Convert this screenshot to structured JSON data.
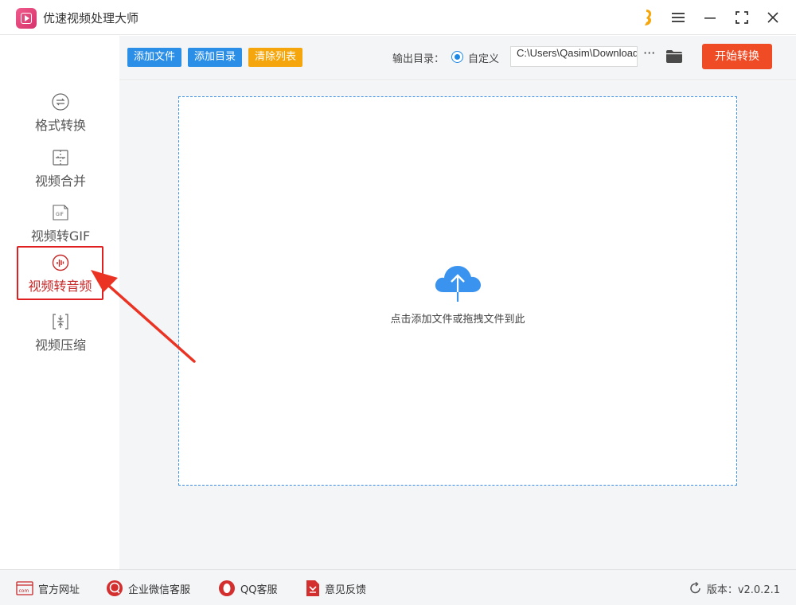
{
  "app": {
    "title": "优速视频处理大师"
  },
  "sidebar": {
    "items": [
      {
        "label": "格式转换"
      },
      {
        "label": "视频合并"
      },
      {
        "label": "视频转GIF"
      },
      {
        "label": "视频转音频"
      },
      {
        "label": "视频压缩"
      }
    ],
    "active_index": 3
  },
  "toolbar": {
    "add_file": "添加文件",
    "add_dir": "添加目录",
    "clear_list": "清除列表",
    "output_label": "输出目录：",
    "custom_label": "自定义",
    "path_value": "C:\\Users\\Qasim\\Downloads",
    "more": "···",
    "start": "开始转换"
  },
  "dropzone": {
    "text": "点击添加文件或拖拽文件到此"
  },
  "footer": {
    "website": "官方网址",
    "wechat": "企业微信客服",
    "qq": "QQ客服",
    "feedback": "意见反馈",
    "version": "版本：v2.0.2.1"
  },
  "colors": {
    "accent_blue": "#2b8fe8",
    "accent_orange": "#f5a60c",
    "start_red": "#ef4b25",
    "active_red": "#e02020"
  }
}
